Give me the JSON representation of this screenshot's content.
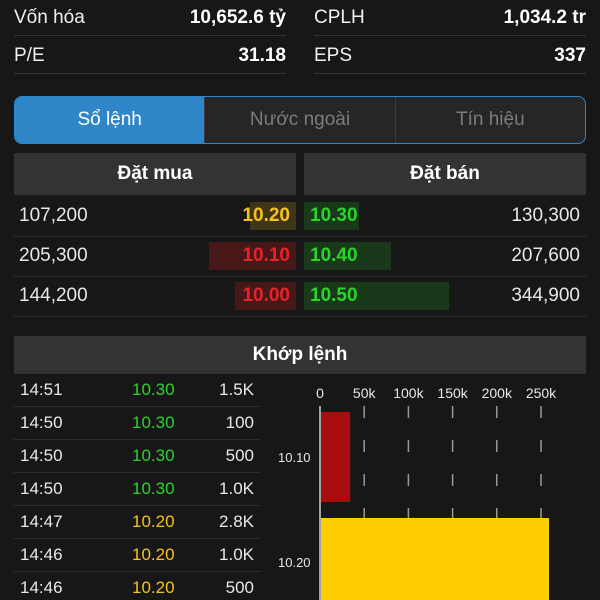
{
  "stats": [
    {
      "label": "Vốn hóa",
      "value": "10,652.6 tỷ",
      "label2": "CPLH",
      "value2": "1,034.2 tr"
    },
    {
      "label": "P/E",
      "value": "31.18",
      "label2": "EPS",
      "value2": "337"
    }
  ],
  "tabs": [
    {
      "label": "Sổ lệnh",
      "active": true
    },
    {
      "label": "Nước ngoài",
      "active": false
    },
    {
      "label": "Tín hiệu",
      "active": false
    }
  ],
  "order_book": {
    "buy_header": "Đặt mua",
    "sell_header": "Đặt bán",
    "rows": [
      {
        "buy_qty": "107,200",
        "buy_price": "10.20",
        "buy_color": "#f7c21e",
        "buy_level": 0.16,
        "sell_price": "10.30",
        "sell_color": "#2ad42a",
        "sell_level": 0.19,
        "sell_qty": "130,300"
      },
      {
        "buy_qty": "205,300",
        "buy_price": "10.10",
        "buy_color": "#e8222a",
        "buy_level": 0.3,
        "sell_price": "10.40",
        "sell_color": "#2ad42a",
        "sell_level": 0.3,
        "sell_qty": "207,600"
      },
      {
        "buy_qty": "144,200",
        "buy_price": "10.00",
        "buy_color": "#e8222a",
        "buy_level": 0.21,
        "sell_price": "10.50",
        "sell_color": "#2ad42a",
        "sell_level": 0.5,
        "sell_qty": "344,900"
      }
    ]
  },
  "match": {
    "header": "Khớp lệnh",
    "trades": [
      {
        "time": "14:51",
        "price": "10.30",
        "color": "#2ad42a",
        "volume": "1.5K"
      },
      {
        "time": "14:50",
        "price": "10.30",
        "color": "#2ad42a",
        "volume": "100"
      },
      {
        "time": "14:50",
        "price": "10.30",
        "color": "#2ad42a",
        "volume": "500"
      },
      {
        "time": "14:50",
        "price": "10.30",
        "color": "#2ad42a",
        "volume": "1.0K"
      },
      {
        "time": "14:47",
        "price": "10.20",
        "color": "#f7c21e",
        "volume": "2.8K"
      },
      {
        "time": "14:46",
        "price": "10.20",
        "color": "#f7c21e",
        "volume": "1.0K"
      },
      {
        "time": "14:46",
        "price": "10.20",
        "color": "#f7c21e",
        "volume": "500"
      }
    ]
  },
  "colors": {
    "accent": "#2f86c9",
    "up": "#2ad42a",
    "ref": "#f7c21e",
    "down": "#e8222a"
  },
  "chart_data": {
    "type": "bar",
    "orientation": "horizontal",
    "x_ticks": [
      "0",
      "50k",
      "100k",
      "150k",
      "200k",
      "250k"
    ],
    "xlim": [
      0,
      260000
    ],
    "categories": [
      "10.10",
      "10.20"
    ],
    "values": [
      33000,
      260000
    ],
    "colors": [
      "#a80c0c",
      "#ffcd00"
    ],
    "grid": true
  }
}
